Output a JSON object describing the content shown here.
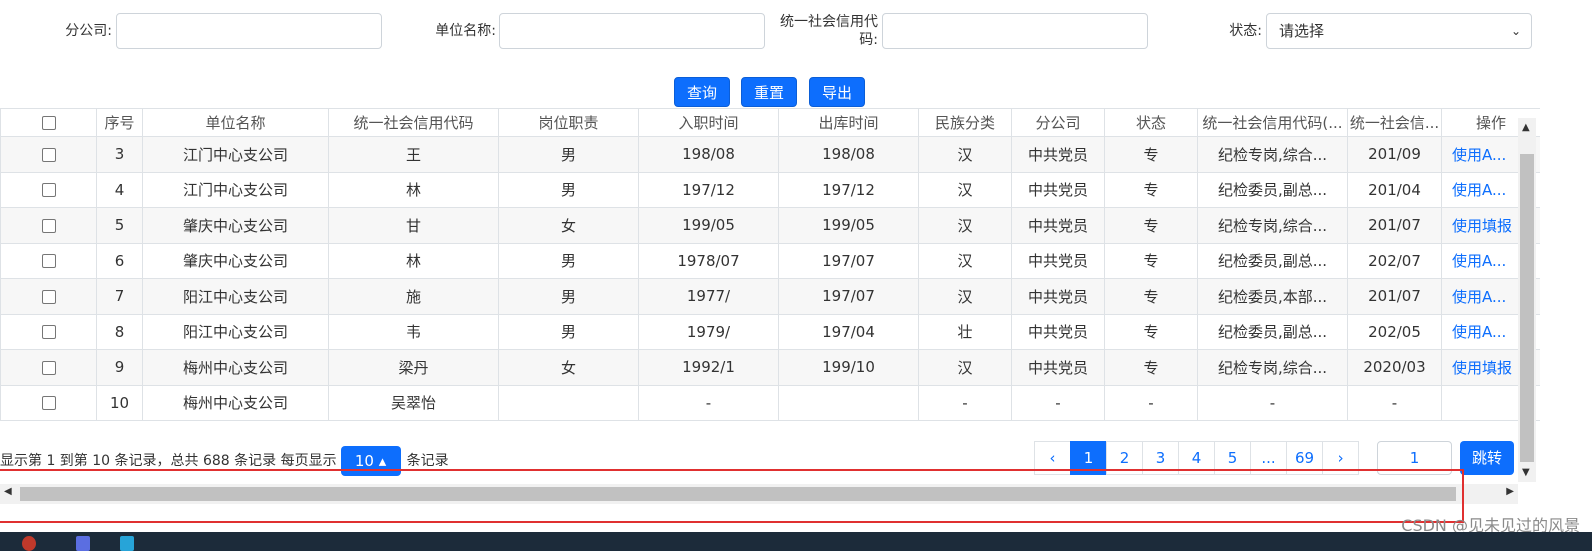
{
  "filters": {
    "branch_label": "分公司:",
    "unit_label": "单位名称:",
    "credit_code_label_line1": "统一社会信用代",
    "credit_code_label_line2": "码:",
    "status_label": "状态:",
    "status_value": "请选择"
  },
  "buttons": {
    "query": "查询",
    "reset": "重置",
    "export": "导出"
  },
  "table": {
    "headers": [
      "序号",
      "单位名称",
      "统一社会信用代码",
      "岗位职责",
      "入职时间",
      "出库时间",
      "民族分类",
      "分公司",
      "状态",
      "统一社会信用代码(...",
      "统一社会信...",
      "操作"
    ],
    "rows": [
      [
        "3",
        "江门中心支公司",
        "王",
        "男",
        "198/08",
        "198/08",
        "汉",
        "中共党员",
        "专",
        "纪检专岗,综合...",
        "201/09",
        "使用A..."
      ],
      [
        "4",
        "江门中心支公司",
        "林",
        "男",
        "197/12",
        "197/12",
        "汉",
        "中共党员",
        "专",
        "纪检委员,副总...",
        "201/04",
        "使用A..."
      ],
      [
        "5",
        "肇庆中心支公司",
        "甘",
        "女",
        "199/05",
        "199/05",
        "汉",
        "中共党员",
        "专",
        "纪检专岗,综合...",
        "201/07",
        "使用填报"
      ],
      [
        "6",
        "肇庆中心支公司",
        "林",
        "男",
        "1978/07",
        "197/07",
        "汉",
        "中共党员",
        "专",
        "纪检委员,副总...",
        "202/07",
        "使用A..."
      ],
      [
        "7",
        "阳江中心支公司",
        "施",
        "男",
        "1977/",
        "197/07",
        "汉",
        "中共党员",
        "专",
        "纪检委员,本部...",
        "201/07",
        "使用A..."
      ],
      [
        "8",
        "阳江中心支公司",
        "韦",
        "男",
        "1979/",
        "197/04",
        "壮",
        "中共党员",
        "专",
        "纪检委员,副总...",
        "202/05",
        "使用A..."
      ],
      [
        "9",
        "梅州中心支公司",
        "梁丹",
        "女",
        "1992/1",
        "199/10",
        "汉",
        "中共党员",
        "专",
        "纪检专岗,综合...",
        "2020/03",
        "使用填报"
      ],
      [
        "10",
        "梅州中心支公司",
        "吴翠怡",
        "",
        "-",
        "",
        "-",
        "-",
        "-",
        "-",
        "-",
        ""
      ]
    ]
  },
  "pagination": {
    "info_prefix": "显示第 1 到第 10 条记录，总共 688 条记录 每页显示",
    "page_size": "10 ▴",
    "info_suffix": "条记录",
    "prev": "‹",
    "pages": [
      "1",
      "2",
      "3",
      "4",
      "5",
      "...",
      "69"
    ],
    "next": "›",
    "current_page": "1",
    "jump_value": "1",
    "jump_label": "跳转"
  },
  "watermark": "CSDN @见未见过的风景"
}
